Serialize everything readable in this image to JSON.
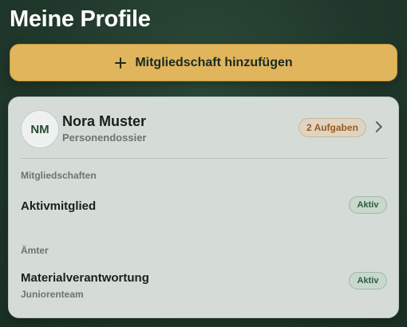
{
  "page": {
    "title": "Meine Profile"
  },
  "actions": {
    "add_membership_label": "Mitgliedschaft hinzufügen"
  },
  "profile": {
    "initials": "NM",
    "name": "Nora Muster",
    "subtitle": "Personendossier",
    "tasks_badge": "2 Aufgaben",
    "sections": {
      "memberships": {
        "label": "Mitgliedschaften",
        "items": [
          {
            "title": "Aktivmitglied",
            "status": "Aktiv"
          }
        ]
      },
      "offices": {
        "label": "Ämter",
        "items": [
          {
            "title": "Materialverantwortung",
            "subtitle": "Juniorenteam",
            "status": "Aktiv"
          }
        ]
      }
    }
  },
  "colors": {
    "background": "#21392c",
    "accent_button": "#e0b55c",
    "card": "#d5dcd8",
    "tasks_badge_text": "#9a5a20",
    "status_active_text": "#2d5a3c"
  },
  "icons": {
    "add": "plus-icon",
    "open_profile": "chevron-right-icon"
  }
}
